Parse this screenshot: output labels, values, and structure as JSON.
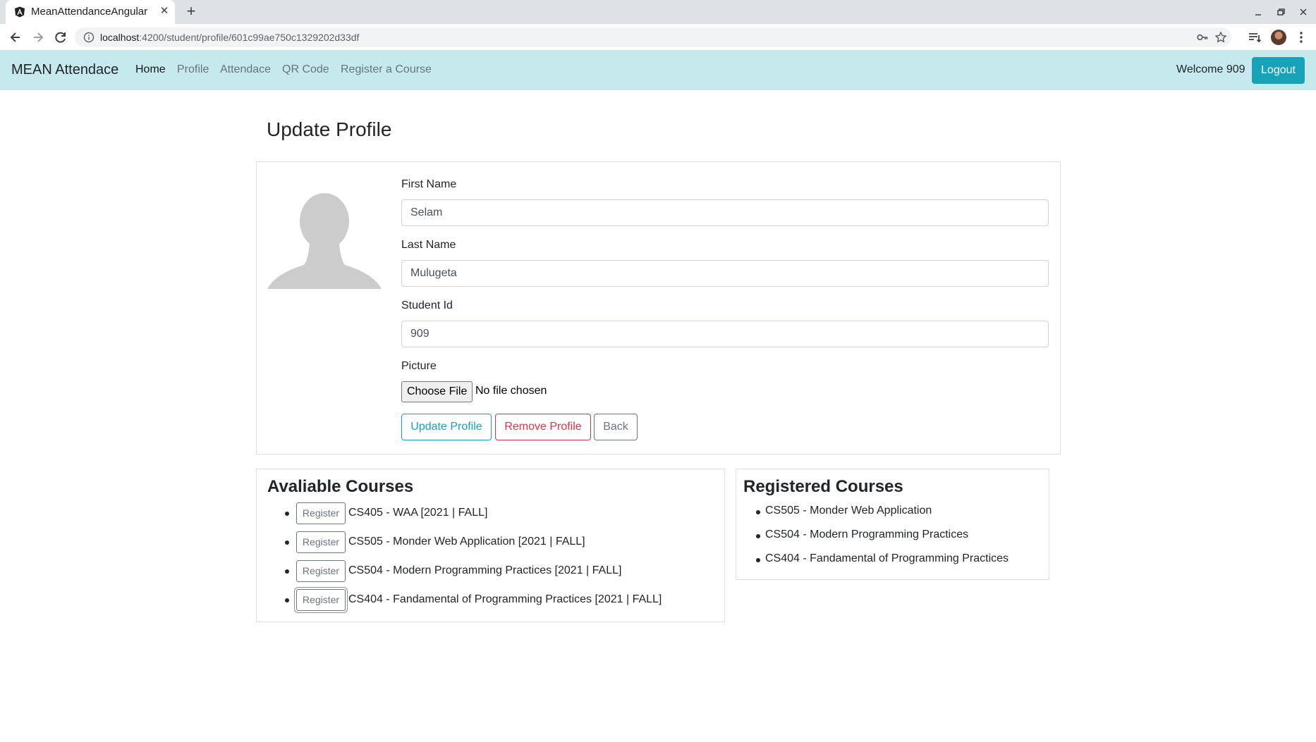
{
  "browser": {
    "tab_title": "MeanAttendanceAngular",
    "url_host": "localhost",
    "url_path": ":4200/student/profile/601c99ae750c1329202d33df"
  },
  "navbar": {
    "brand": "MEAN Attendace",
    "links": [
      "Home",
      "Profile",
      "Attendace",
      "QR Code",
      "Register a Course"
    ],
    "welcome": "Welcome 909",
    "logout": "Logout"
  },
  "profile": {
    "title": "Update Profile",
    "first_name_label": "First Name",
    "first_name_value": "Selam",
    "last_name_label": "Last Name",
    "last_name_value": "Mulugeta",
    "student_id_label": "Student Id",
    "student_id_value": "909",
    "picture_label": "Picture",
    "choose_file": "Choose File",
    "file_status": "No file chosen",
    "update_button": "Update Profile",
    "remove_button": "Remove Profile",
    "back_button": "Back"
  },
  "available": {
    "title": "Avaliable Courses",
    "register_label": "Register",
    "courses": [
      "CS405 - WAA [2021 | FALL]",
      "CS505 - Monder Web Application [2021 | FALL]",
      "CS504 - Modern Programming Practices [2021 | FALL]",
      "CS404 - Fandamental of Programming Practices [2021 | FALL]"
    ]
  },
  "registered": {
    "title": "Registered Courses",
    "courses": [
      "CS505 - Monder Web Application",
      "CS504 - Modern Programming Practices",
      "CS404 - Fandamental of Programming Practices"
    ]
  },
  "colors": {
    "navbar_bg": "#c6e9ee",
    "info": "#17a2b8",
    "danger": "#dc3545",
    "secondary": "#6c757d"
  }
}
